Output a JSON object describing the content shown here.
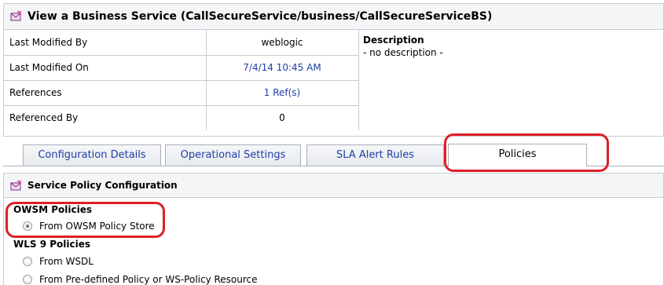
{
  "header": {
    "title": "View a Business Service (CallSecureService/business/CallSecureServiceBS)",
    "icon": "service-envelope-icon"
  },
  "info": {
    "rows": [
      {
        "label": "Last Modified By",
        "value": "weblogic"
      },
      {
        "label": "Last Modified On",
        "value": "7/4/14 10:45 AM"
      },
      {
        "label": "References",
        "value": "1 Ref(s)"
      },
      {
        "label": "Referenced By",
        "value": "0"
      }
    ],
    "description_label": "Description",
    "description_value": "- no description -"
  },
  "tabs": [
    {
      "label": "Configuration Details",
      "active": false
    },
    {
      "label": "Operational Settings",
      "active": false
    },
    {
      "label": "SLA Alert Rules",
      "active": false
    },
    {
      "label": "Policies",
      "active": true
    }
  ],
  "policy": {
    "title": "Service Policy Configuration",
    "owsm_label": "OWSM Policies",
    "owsm_option": "From OWSM Policy Store",
    "wls_label": "WLS 9 Policies",
    "wls_option_1": "From WSDL",
    "wls_option_2": "From Pre-defined Policy or WS-Policy Resource"
  },
  "colors": {
    "link": "#1f3fa6",
    "highlight": "#dd1f26",
    "border": "#c7ccd3"
  }
}
